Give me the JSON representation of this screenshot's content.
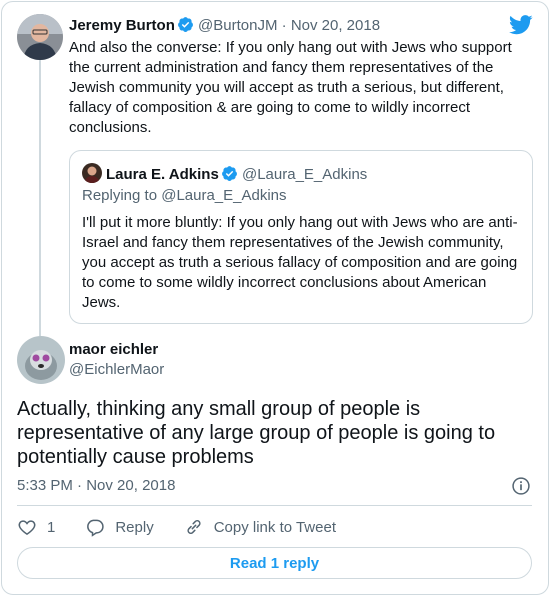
{
  "colors": {
    "accent": "#1d9bf0",
    "muted": "#536471",
    "border": "#cfd9de",
    "text": "#0f1419"
  },
  "parent_tweet": {
    "author_name": "Jeremy Burton",
    "handle": "@BurtonJM",
    "separator": "·",
    "date": "Nov 20, 2018",
    "text": "And also the converse: If you only hang out with Jews who support the current administration and fancy them representatives of the Jewish community you will accept as truth a serious, but different, fallacy of composition & are going to come to wildly incorrect conclusions.",
    "verified": true
  },
  "quoted_tweet": {
    "author_name": "Laura E. Adkins",
    "handle": "@Laura_E_Adkins",
    "replying_to": "Replying to @Laura_E_Adkins",
    "text": "I'll put it more bluntly: If you only hang out with Jews who are anti-Israel and fancy them representatives of the Jewish community, you accept as truth a serious fallacy of composition and are going to come to some wildly incorrect conclusions about American Jews.",
    "verified": true
  },
  "main_tweet": {
    "author_name": "maor eichler",
    "handle": "@EichlerMaor",
    "text": "Actually, thinking any small group of people is representative of any large group of people is going to potentially cause problems",
    "time": "5:33 PM",
    "separator": "·",
    "date": "Nov 20, 2018"
  },
  "actions": {
    "like_count": "1",
    "reply_label": "Reply",
    "copy_link_label": "Copy link to Tweet"
  },
  "read_replies_label": "Read 1 reply",
  "icons": [
    "twitter-bird-icon",
    "verified-badge-icon",
    "info-icon",
    "heart-icon",
    "reply-icon",
    "link-icon"
  ]
}
